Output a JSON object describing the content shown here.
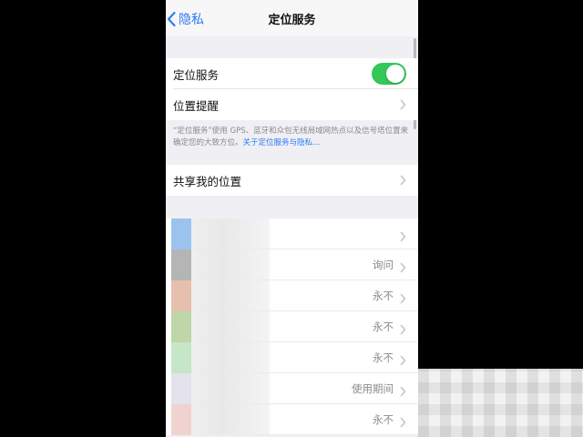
{
  "navbar": {
    "back_label": "隐私",
    "title": "定位服务"
  },
  "settings": {
    "location_services_label": "定位服务",
    "location_services_enabled": true,
    "location_alerts_label": "位置提醒",
    "footnote_text": "“定位服务”使用 GPS、蓝牙和众包无线局域网热点以及信号塔位置来确定您的大致方位。",
    "footnote_link": "关于定位服务与隐私…",
    "share_location_label": "共享我的位置"
  },
  "apps": [
    {
      "value": "",
      "thumb_color": "#9cc3ee"
    },
    {
      "value": "询问",
      "thumb_color": "#b5b5b5"
    },
    {
      "value": "永不",
      "thumb_color": "#e6bfae"
    },
    {
      "value": "永不",
      "thumb_color": "#bfd6a8"
    },
    {
      "value": "永不",
      "thumb_color": "#c6e6c8"
    },
    {
      "value": "使用期间",
      "thumb_color": "#e4e2ec"
    },
    {
      "value": "永不",
      "thumb_color": "#f0d3cf"
    }
  ],
  "colors": {
    "accent": "#2f7bf5",
    "toggle_on": "#34c759",
    "background": "#efeff4"
  }
}
